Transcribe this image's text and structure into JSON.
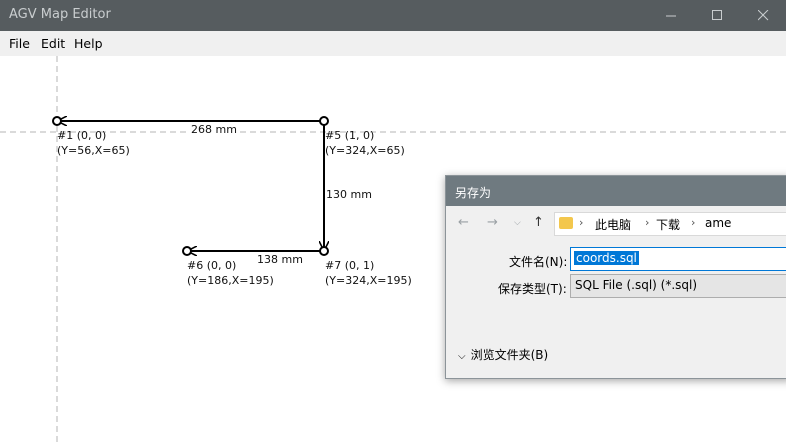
{
  "window": {
    "title": "AGV Map Editor"
  },
  "menu": {
    "file": "File",
    "edit": "Edit",
    "help": "Help"
  },
  "map": {
    "nodes": [
      {
        "id": "#1 (0, 0)",
        "coords": "(Y=56,X=65)"
      },
      {
        "id": "#5 (1, 0)",
        "coords": "(Y=324,X=65)"
      },
      {
        "id": "#6 (0, 0)",
        "coords": "(Y=186,X=195)"
      },
      {
        "id": "#7 (0, 1)",
        "coords": "(Y=324,X=195)"
      }
    ],
    "distances": {
      "top": "268 mm",
      "right": "130 mm",
      "bottom": "138 mm"
    }
  },
  "dialog": {
    "title": "另存为",
    "breadcrumb": [
      "此电脑",
      "下载",
      "ame"
    ],
    "filename_label": "文件名(N):",
    "filename_value": "coords.sql",
    "filetype_label": "保存类型(T):",
    "filetype_value": "SQL File (.sql) (*.sql)",
    "browse_label": "浏览文件夹(B)"
  }
}
